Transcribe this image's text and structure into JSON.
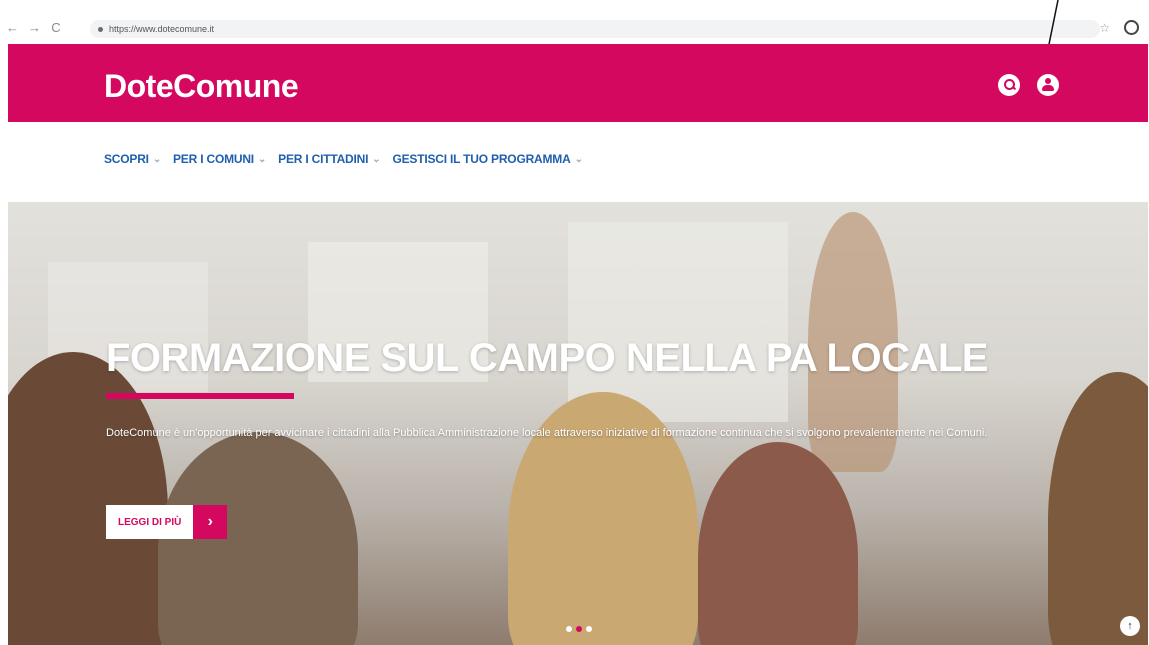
{
  "browser": {
    "url": "https://www.dotecomune.it",
    "back_glyph": "←",
    "forward_glyph": "→",
    "reload_glyph": "C",
    "star_glyph": "☆"
  },
  "header": {
    "logo": "DoteComune",
    "bg_color": "#d4085e",
    "icons": [
      "search-icon",
      "user-icon"
    ]
  },
  "nav": {
    "items": [
      {
        "label": "SCOPRI"
      },
      {
        "label": "PER I COMUNI"
      },
      {
        "label": "PER I CITTADINI"
      },
      {
        "label": "GESTISCI IL TUO PROGRAMMA"
      }
    ],
    "caret": "⌄"
  },
  "hero": {
    "title": "FORMAZIONE SUL CAMPO NELLA PA LOCALE",
    "description": "DoteComune è un'opportunità per avvicinare i cittadini alla Pubblica Amministrazione locale attraverso iniziative di formazione continua che si svolgono prevalentemente nei Comuni.",
    "cta_label": "LEGGI DI PIÙ",
    "cta_arrow": "›",
    "slides": 3,
    "active_slide": 2
  },
  "scroll_top_glyph": "↑"
}
